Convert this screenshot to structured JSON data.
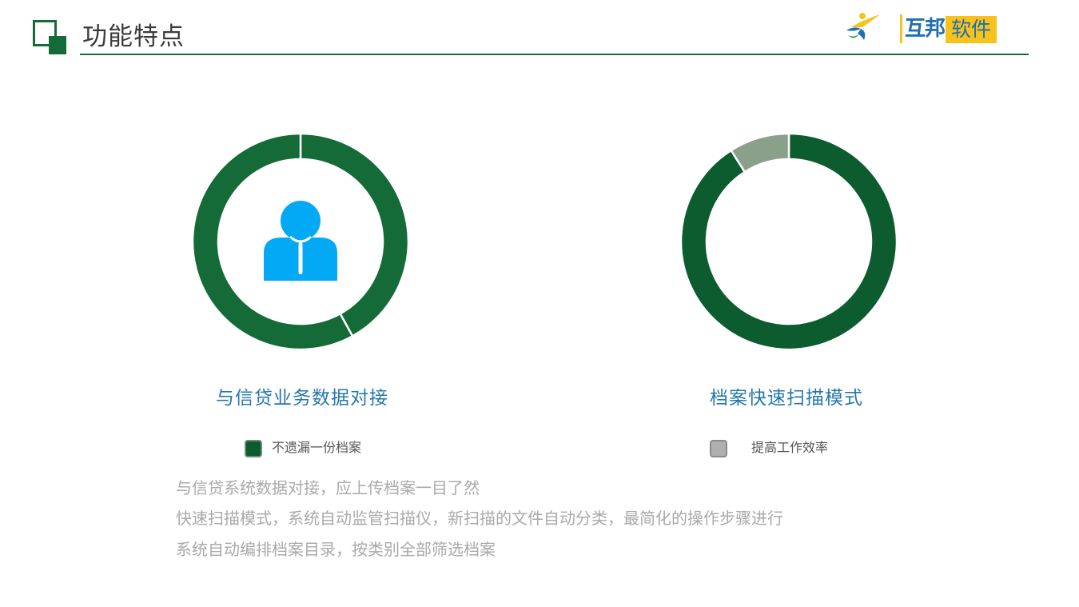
{
  "header": {
    "title": "功能特点",
    "logo": {
      "name_part1": "互邦",
      "name_part2": "软件"
    }
  },
  "charts": [
    {
      "title": "与信贷业务数据对接",
      "legend_label": "不遗漏一份档案",
      "icon": "person-icon"
    },
    {
      "title": "档案快速扫描模式",
      "legend_label": "提高工作效率"
    }
  ],
  "chart_data": [
    {
      "type": "pie",
      "title": "与信贷业务数据对接",
      "style": "donut",
      "slices": [
        {
          "label": "",
          "value": 42,
          "color": "#156b38"
        },
        {
          "label": "不遗漏一份档案",
          "value": 58,
          "color": "#156b38"
        }
      ]
    },
    {
      "type": "pie",
      "title": "档案快速扫描模式",
      "style": "donut",
      "slices": [
        {
          "label": "",
          "value": 91,
          "color": "#0d5c2f"
        },
        {
          "label": "提高工作效率",
          "value": 9,
          "color": "#8aa08b"
        }
      ]
    }
  ],
  "description": [
    "与信贷系统数据对接，应上传档案一目了然",
    "快速扫描模式，系统自动监管扫描仪，新扫描的文件自动分类，最简化的操作步骤进行",
    "系统自动编排档案目录，按类别全部筛选档案"
  ],
  "colors": {
    "brand_green": "#156b38",
    "dark_green": "#0d5c2f",
    "gray_green": "#8aa08b",
    "title_blue": "#2478ad",
    "icon_blue": "#03a9f4",
    "logo_yellow": "#f7c21a",
    "logo_blue": "#1f6fb2"
  }
}
